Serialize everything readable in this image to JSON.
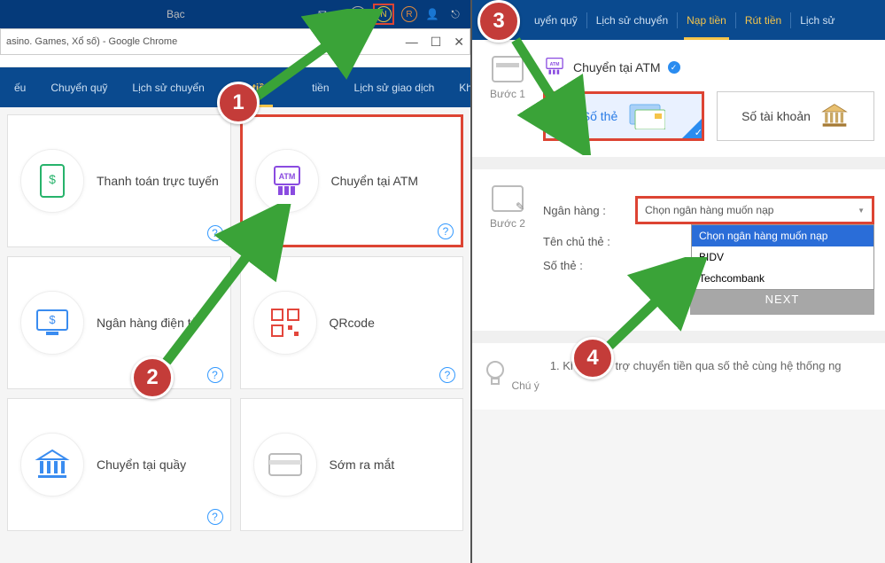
{
  "topbar": {
    "tier": "Bạc",
    "mail_count": "0",
    "c_label": "C",
    "n_label": "N",
    "r_label": "R"
  },
  "chrome": {
    "title": "asino. Games, Xổ số) - Google Chrome",
    "min": "—",
    "max": "☐",
    "close": "✕"
  },
  "nav_left": {
    "items": [
      "ếu",
      "Chuyển quỹ",
      "Lịch sử chuyển",
      "Nạp tiền",
      "tiền",
      "Lịch sử giao dịch",
      "Khuyến mã"
    ],
    "active_index": 3
  },
  "methods": [
    {
      "label": "Thanh toán trực tuyến",
      "icon_data_name": "online-payment-icon"
    },
    {
      "label": "Chuyển tại ATM",
      "icon_data_name": "atm-icon",
      "selected": true
    },
    {
      "label": "Ngân hàng điện tử",
      "icon_data_name": "ebank-icon"
    },
    {
      "label": "QRcode",
      "icon_data_name": "qrcode-icon"
    },
    {
      "label": "Chuyển tại quầy",
      "icon_data_name": "counter-icon"
    },
    {
      "label": "Sớm ra mắt",
      "icon_data_name": "cominghold-icon",
      "no_help": true
    }
  ],
  "nav_right": {
    "items": [
      "uyển quỹ",
      "Lịch sử chuyển",
      "Nạp tiền",
      "Rút tiền",
      "Lịch sử"
    ],
    "active_index": 2
  },
  "step1": {
    "side_label": "Bước 1",
    "title": "Chuyển tại ATM",
    "choice_card": "Số thẻ",
    "choice_account": "Số tài khoản"
  },
  "step2": {
    "side_label": "Bước 2",
    "bank_label": "Ngân hàng :",
    "owner_label": "Tên chủ thẻ :",
    "cardnum_label": "Số thẻ :",
    "select_placeholder": "Chọn ngân hàng muốn nạp",
    "options": [
      "Chọn ngân hàng muốn nạp",
      "BIDV",
      "Techcombank"
    ],
    "next": "NEXT"
  },
  "note": {
    "side_label": "Chú ý",
    "text": "1.  Không hỗ trợ chuyển tiền qua số thẻ cùng hệ thống ng"
  },
  "badges": {
    "b1": "1",
    "b2": "2",
    "b3": "3",
    "b4": "4"
  },
  "help_glyph": "?"
}
